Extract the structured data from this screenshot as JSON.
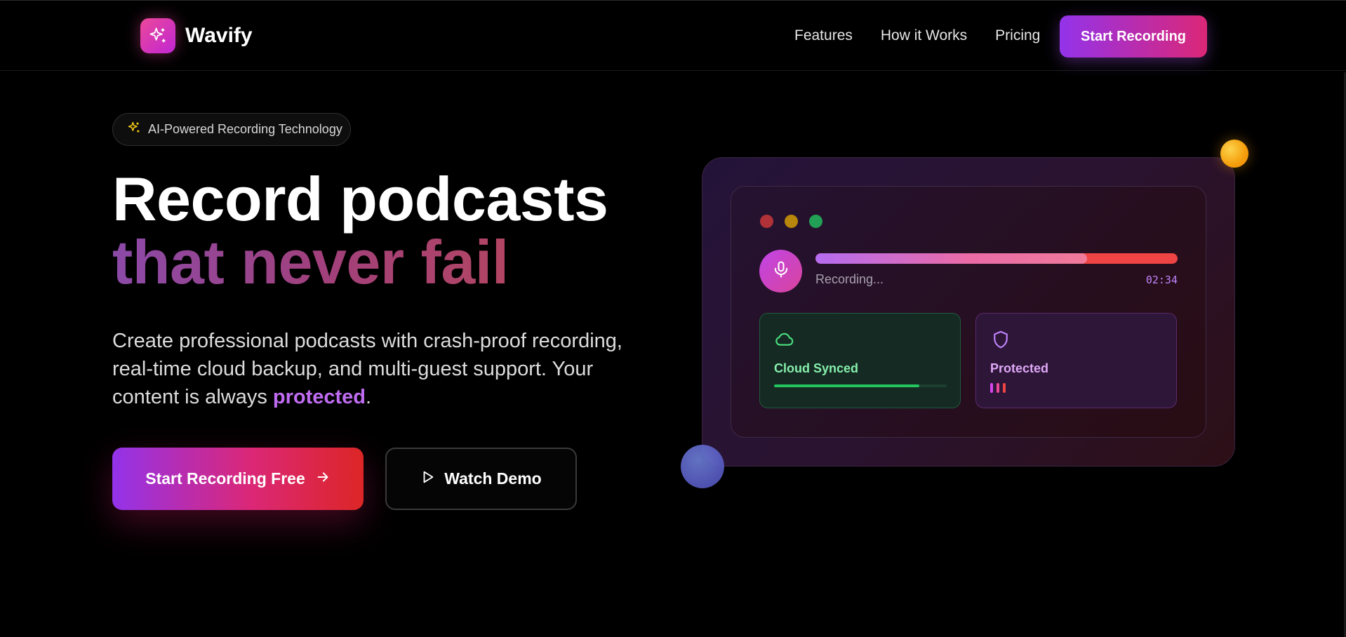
{
  "nav": {
    "brand_name": "Wavify",
    "brand_icon": "sparkles-icon",
    "links": [
      "Features",
      "How it Works",
      "Pricing"
    ],
    "cta_label": "Start Recording"
  },
  "hero": {
    "badge_icon": "sparkles-icon",
    "badge_text": "AI-Powered Recording Technology",
    "headline_line1": "Record podcasts",
    "headline_line2": "that never fail",
    "subtext_before": "Create professional podcasts with crash-proof recording, real-time cloud backup, and multi-guest support. Your content is always ",
    "subtext_highlight": "protected",
    "subtext_after": ".",
    "primary_cta": "Start Recording Free",
    "secondary_cta": "Watch Demo"
  },
  "mockup": {
    "recording_label": "Recording...",
    "recording_time": "02:34",
    "recording_progress": 0.75,
    "tiles": {
      "cloud": {
        "label": "Cloud Synced",
        "icon": "cloud-icon",
        "progress": 0.84
      },
      "protected": {
        "label": "Protected",
        "icon": "shield-icon",
        "bar_colors": [
          "#d946ef",
          "#ec4899",
          "#ef4444"
        ]
      }
    }
  },
  "colors": {
    "accent_purple": "#9333ea",
    "accent_pink": "#db2777",
    "accent_red": "#dc2626",
    "highlight": "#c06cf2",
    "success": "#22c55e"
  }
}
